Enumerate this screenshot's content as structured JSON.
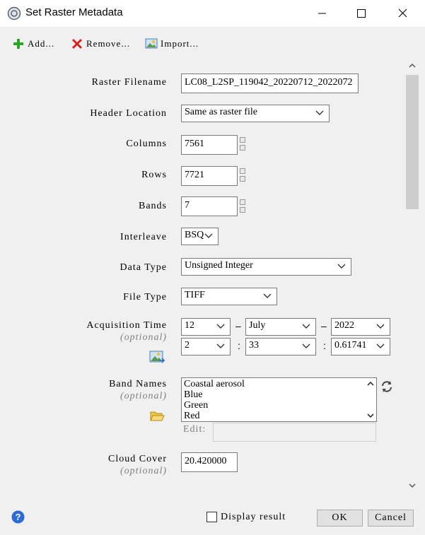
{
  "window": {
    "title": "Set Raster Metadata",
    "icons": {
      "app": "app-icon",
      "minimize": "minimize-icon",
      "maximize": "maximize-icon",
      "close": "close-icon"
    }
  },
  "toolbar": {
    "add_label": "Add...",
    "remove_label": "Remove...",
    "import_label": "Import...",
    "icons": {
      "add": "plus-icon",
      "remove": "red-x-icon",
      "import": "image-import-icon"
    }
  },
  "form": {
    "raster_filename": {
      "label": "Raster Filename",
      "value": "LC08_L2SP_119042_20220712_2022072"
    },
    "header_location": {
      "label": "Header Location",
      "value": "Same as raster file"
    },
    "columns": {
      "label": "Columns",
      "value": "7561"
    },
    "rows": {
      "label": "Rows",
      "value": "7721"
    },
    "bands": {
      "label": "Bands",
      "value": "7"
    },
    "interleave": {
      "label": "Interleave",
      "value": "BSQ"
    },
    "data_type": {
      "label": "Data Type",
      "value": "Unsigned Integer"
    },
    "file_type": {
      "label": "File Type",
      "value": "TIFF"
    },
    "acquisition_time": {
      "label": "Acquisition Time",
      "optional": "(optional)",
      "day": "12",
      "month": "July",
      "year": "2022",
      "hour": "2",
      "minute": "33",
      "second": "0.61741",
      "dash": "–",
      "colon": ":"
    },
    "band_names": {
      "label": "Band Names",
      "optional": "(optional)",
      "items": [
        "Coastal aerosol",
        "Blue",
        "Green",
        "Red"
      ],
      "edit_label": "Edit:",
      "edit_value": ""
    },
    "cloud_cover": {
      "label": "Cloud Cover",
      "optional": "(optional)",
      "value": "20.420000"
    }
  },
  "footer": {
    "display_result_label": "Display result",
    "display_result_checked": false,
    "ok_label": "OK",
    "cancel_label": "Cancel",
    "help_icon": "help-icon"
  },
  "colors": {
    "accent_help": "#2a6bd6",
    "remove_red": "#d62020",
    "add_green": "#2aa52a"
  }
}
